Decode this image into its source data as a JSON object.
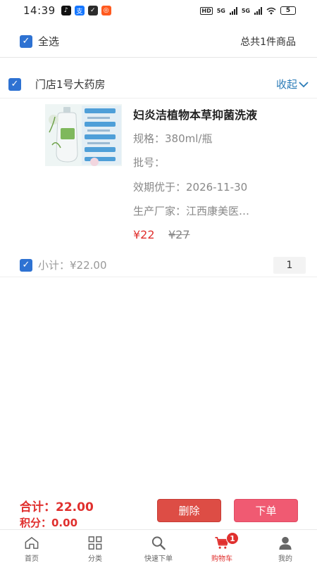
{
  "status_bar": {
    "time": "14:39",
    "network_1": "5G",
    "network_2": "5G",
    "hd_label": "HD",
    "battery": "5"
  },
  "header": {
    "select_all_label": "全选",
    "total_count_text": "总共1件商品"
  },
  "store": {
    "name": "门店1号大药房",
    "collapse_label": "收起"
  },
  "product": {
    "title": "妇炎洁植物本草抑菌洗液",
    "spec": "规格：380ml/瓶",
    "batch": "批号：",
    "expiry": "效期优于：2026-11-30",
    "manufacturer": "生产厂家：江西康美医…",
    "price": "¥22",
    "original_price": "¥27",
    "quantity": "1"
  },
  "subtotal": {
    "text": "小计：¥22.00"
  },
  "footer": {
    "total_text": "合计：22.00",
    "points_text": "积分：0.00",
    "delete_label": "删除",
    "order_label": "下单"
  },
  "tabbar": {
    "tabs": [
      {
        "label": "首页",
        "icon": "home-icon"
      },
      {
        "label": "分类",
        "icon": "grid-icon"
      },
      {
        "label": "快速下单",
        "icon": "search-icon"
      },
      {
        "label": "购物车",
        "icon": "cart-icon",
        "active": true,
        "badge": "1"
      },
      {
        "label": "我的",
        "icon": "user-icon"
      }
    ]
  },
  "colors": {
    "accent_blue": "#2e72d2",
    "price_red": "#e0302e",
    "delete_button": "#dd4d45",
    "order_button": "#f05a72",
    "link_blue": "#2a7bb7"
  }
}
